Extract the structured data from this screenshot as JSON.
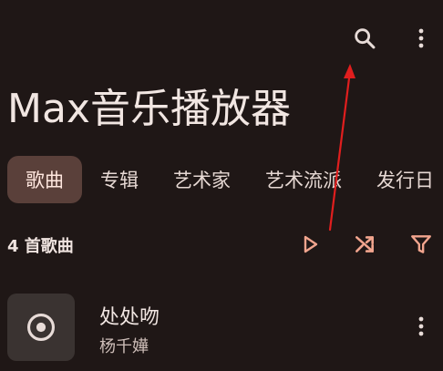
{
  "app": {
    "title": "Max音乐播放器"
  },
  "toolbar": {
    "search_icon": "search-icon",
    "more_icon": "more-vert-icon"
  },
  "tabs": [
    {
      "label": "歌曲",
      "active": true
    },
    {
      "label": "专辑",
      "active": false
    },
    {
      "label": "艺术家",
      "active": false
    },
    {
      "label": "艺术流派",
      "active": false
    },
    {
      "label": "发行日",
      "active": false
    }
  ],
  "songs_header": {
    "count_text": "4 首歌曲",
    "play_icon": "play-icon",
    "shuffle_icon": "shuffle-icon",
    "filter_icon": "filter-icon"
  },
  "songs": [
    {
      "title": "处处吻",
      "artist": "杨千嬅",
      "art_icon": "disc-icon",
      "more_icon": "more-vert-icon"
    }
  ],
  "colors": {
    "background": "#1f1716",
    "accent": "#f2a58e",
    "active_tab_bg": "#5a403a",
    "annotation_arrow": "#e01e1e"
  }
}
